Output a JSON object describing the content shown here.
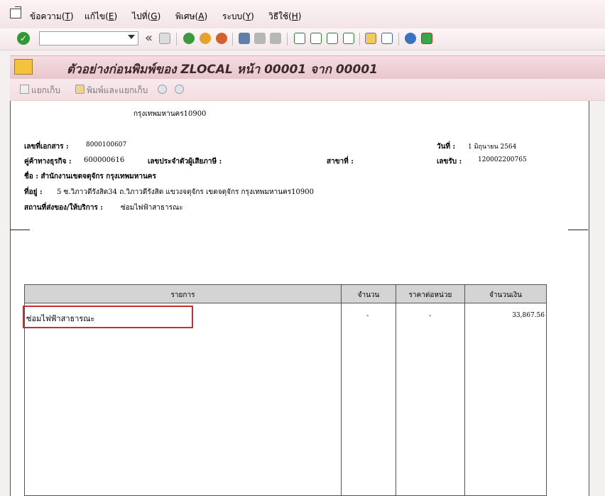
{
  "menubar": {
    "items": [
      {
        "text": "ข้อความ(",
        "key": "T",
        "tail": ")"
      },
      {
        "text": "แก้ไข(",
        "key": "E",
        "tail": ")"
      },
      {
        "text": "ไปที่(",
        "key": "G",
        "tail": ")"
      },
      {
        "text": "พิเศษ(",
        "key": "A",
        "tail": ")"
      },
      {
        "text": "ระบบ(",
        "key": "Y",
        "tail": ")"
      },
      {
        "text": "วิธีใช้(",
        "key": "H",
        "tail": ")"
      }
    ]
  },
  "toolbar": {
    "command_value": "",
    "back_arrows": "«",
    "icons": [
      "check-icon",
      "save-icon",
      "back-icon",
      "exit-icon",
      "cancel-icon",
      "print-icon",
      "find-icon",
      "find-next-icon",
      "first-page-icon",
      "prev-page-icon",
      "next-page-icon",
      "last-page-icon",
      "new-session-icon",
      "shortcut-icon",
      "help-icon",
      "customize-icon"
    ]
  },
  "title": {
    "text": "ตัวอย่างก่อนพิมพ์ของ ZLOCAL หน้า 00001 จาก 00001"
  },
  "app_toolbar": {
    "spool_label": "แยกเก็บ",
    "print_spool_label": "พิมพ์และแยกเก็บ"
  },
  "document": {
    "address_line_top": "กรุงเทพมหานคร10900",
    "doc_no_label": "เลขที่เอกสาร :",
    "doc_no_value": "8000100607",
    "date_label": "วันที่ :",
    "date_value": "1  มิถุนายน 2564",
    "partner_label": "คู่ค้าทางธุรกิจ :",
    "partner_value": "600000616",
    "tax_id_label": "เลขประจำตัวผู้เสียภาษี :",
    "branch_label": "สาขาที่ :",
    "receipt_label": "เลขรับ :",
    "receipt_value": "120002200765",
    "name_line": "ชื่อ : สำนักงานเขตจตุจักร กรุงเทพมหานคร",
    "address_label": "ที่อยู่ :",
    "address_value": "5    ซ.วิภาวดีรังสิต34 ถ.วิภาวดีรังสิต แขวงจตุจักร เขตจตุจักร กรุงเทพมหานคร10900",
    "service_label": "สถานที่ส่งของ/ให้บริการ :",
    "service_value": "ซ่อมไฟฟ้าสาธารณะ"
  },
  "table": {
    "headers": [
      "รายการ",
      "จำนวน",
      "ราคาต่อหน่วย",
      "จำนวนเงิน"
    ],
    "rows": [
      {
        "item": "ซ่อมไฟฟ้าสาธารณะ",
        "qty": "-",
        "unit_price": "-",
        "amount": "33,867.56"
      }
    ]
  }
}
